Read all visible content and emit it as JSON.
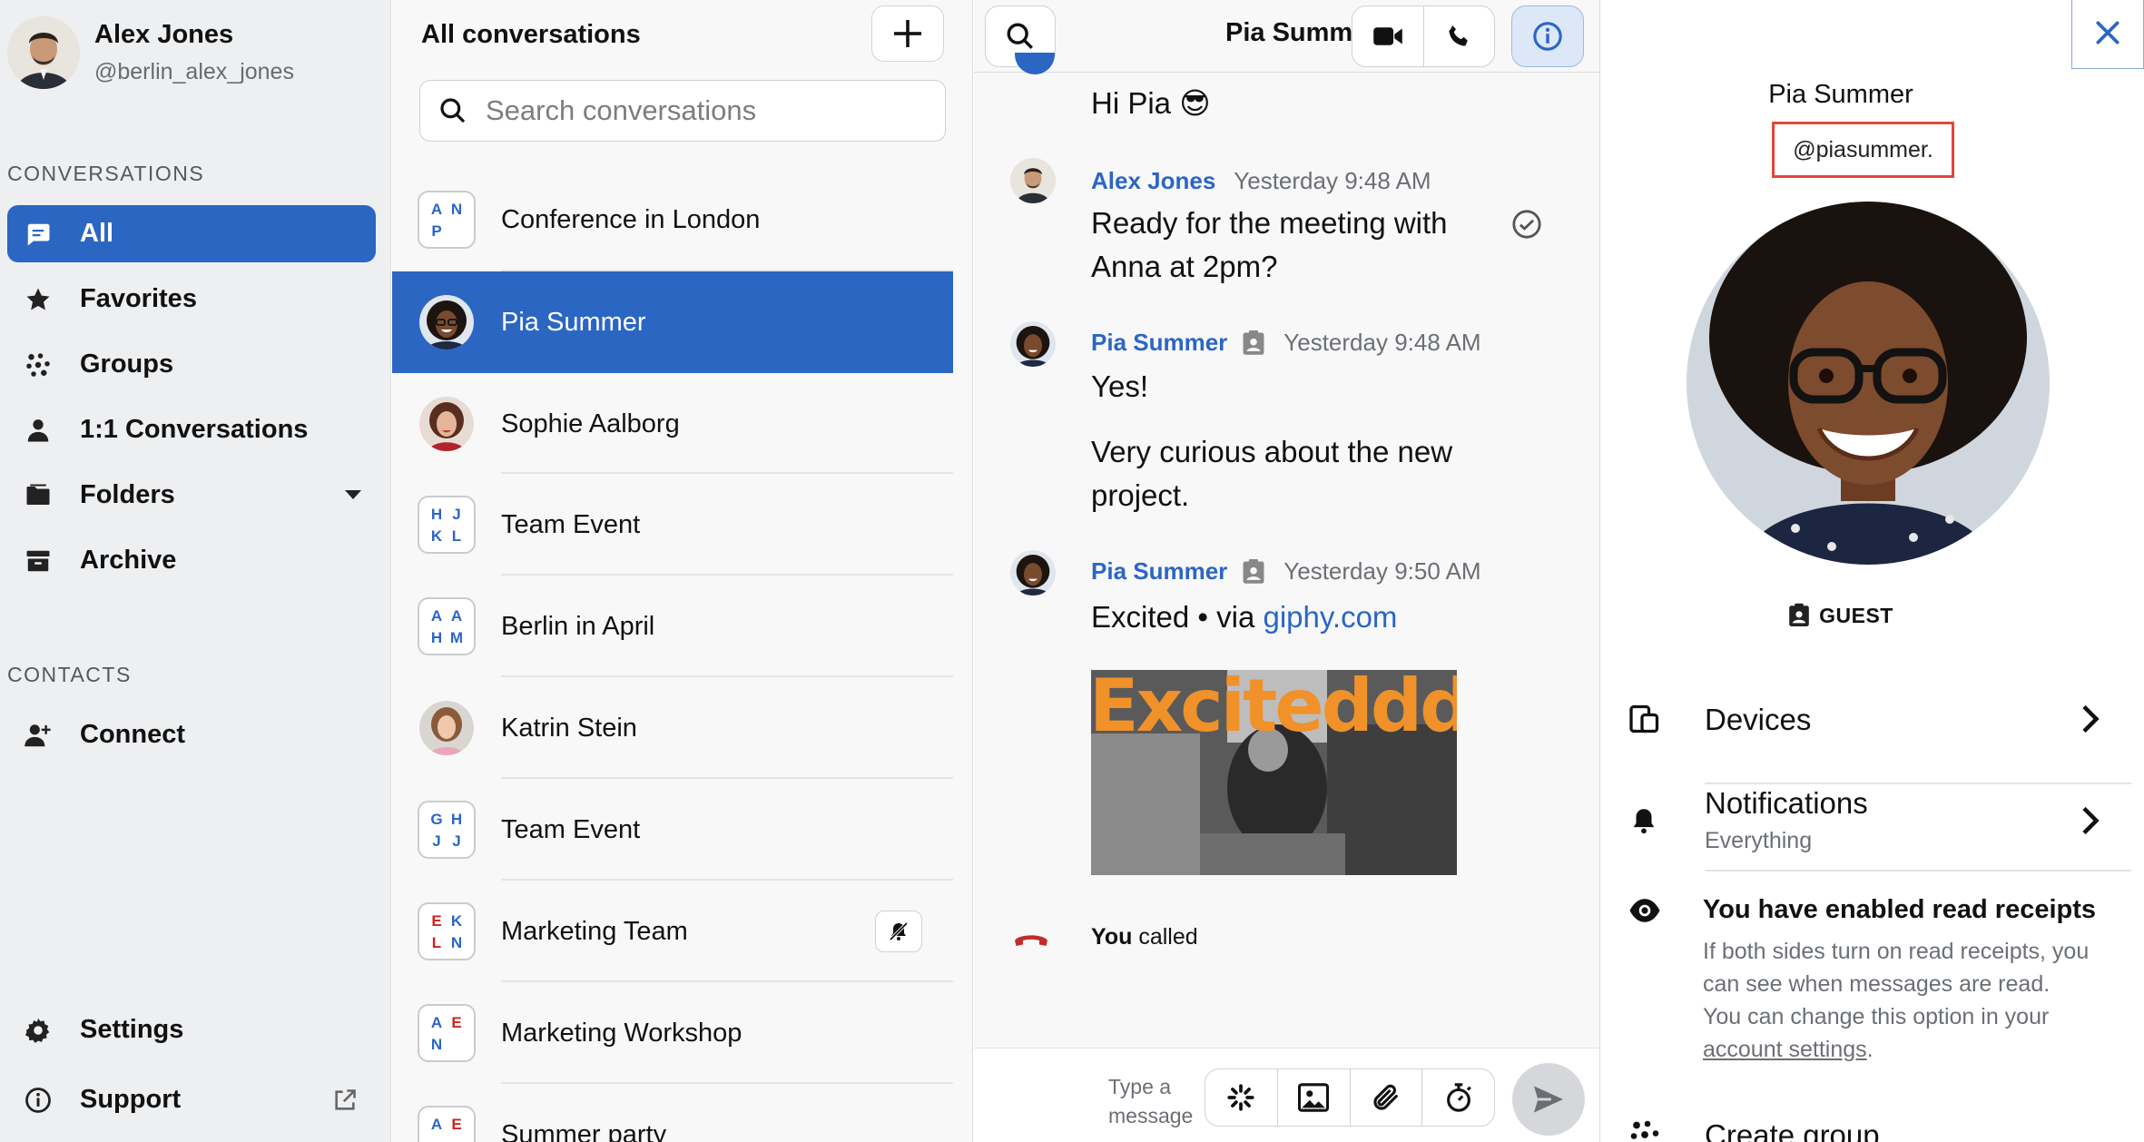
{
  "profile": {
    "name": "Alex Jones",
    "handle": "@berlin_alex_jones"
  },
  "sidebar": {
    "conversations_label": "CONVERSATIONS",
    "items": [
      {
        "label": "All",
        "icon": "speech-bubble-icon",
        "active": true
      },
      {
        "label": "Favorites",
        "icon": "star-icon"
      },
      {
        "label": "Groups",
        "icon": "groups-icon"
      },
      {
        "label": "1:1 Conversations",
        "icon": "person-icon"
      },
      {
        "label": "Folders",
        "icon": "folder-icon"
      },
      {
        "label": "Archive",
        "icon": "archive-icon"
      }
    ],
    "contacts_label": "CONTACTS",
    "connect_label": "Connect",
    "settings_label": "Settings",
    "support_label": "Support"
  },
  "conversation_list": {
    "title": "All conversations",
    "search_placeholder": "Search conversations",
    "items": [
      {
        "name": "Conference in London",
        "initials": [
          "A",
          "N",
          "P",
          ""
        ]
      },
      {
        "name": "Pia Summer",
        "active": true
      },
      {
        "name": "Sophie Aalborg"
      },
      {
        "name": "Team Event",
        "initials": [
          "H",
          "J",
          "K",
          "L"
        ]
      },
      {
        "name": "Berlin in April",
        "initials": [
          "A",
          "A",
          "H",
          "M"
        ]
      },
      {
        "name": "Katrin Stein"
      },
      {
        "name": "Team Event",
        "initials": [
          "G",
          "H",
          "J",
          "J"
        ]
      },
      {
        "name": "Marketing Team",
        "initials": [
          "E",
          "K",
          "L",
          "N"
        ],
        "muted": true
      },
      {
        "name": "Marketing Workshop",
        "initials": [
          "A",
          "E",
          "N",
          ""
        ]
      },
      {
        "name": "Summer party",
        "initials": [
          "A",
          "E",
          "",
          ""
        ]
      }
    ]
  },
  "chat": {
    "title": "Pia Summ...",
    "messages": [
      {
        "text": "Hi Pia 😎"
      },
      {
        "sender": "Alex Jones",
        "time": "Yesterday 9:48 AM",
        "text": "Ready for the meeting with Anna at 2pm?"
      },
      {
        "sender": "Pia Summer",
        "time": "Yesterday 9:48 AM",
        "text1": "Yes!",
        "text2": "Very curious about the new project."
      },
      {
        "sender": "Pia Summer",
        "time": "Yesterday 9:50 AM",
        "text": "Excited • via ",
        "link": "giphy.com",
        "gif_caption": "Exciteddd"
      }
    ],
    "call": {
      "actor": "You",
      "action": "called"
    },
    "composer_placeholder": "Type a message"
  },
  "details": {
    "name": "Pia Summer",
    "handle": "@piasummer.",
    "role": "GUEST",
    "devices_label": "Devices",
    "notifications_label": "Notifications",
    "notifications_value": "Everything",
    "read_receipts_title": "You have enabled read receipts",
    "read_receipts_text": "If both sides turn on read receipts, you can see when messages are read.",
    "read_receipts_text2": "You can change this option in your",
    "account_settings_link": "account settings",
    "create_group_label": "Create group"
  },
  "colors": {
    "accent": "#2b66c3",
    "sidebar_bg": "#eeeff1",
    "highlight_red": "#e0473a"
  }
}
